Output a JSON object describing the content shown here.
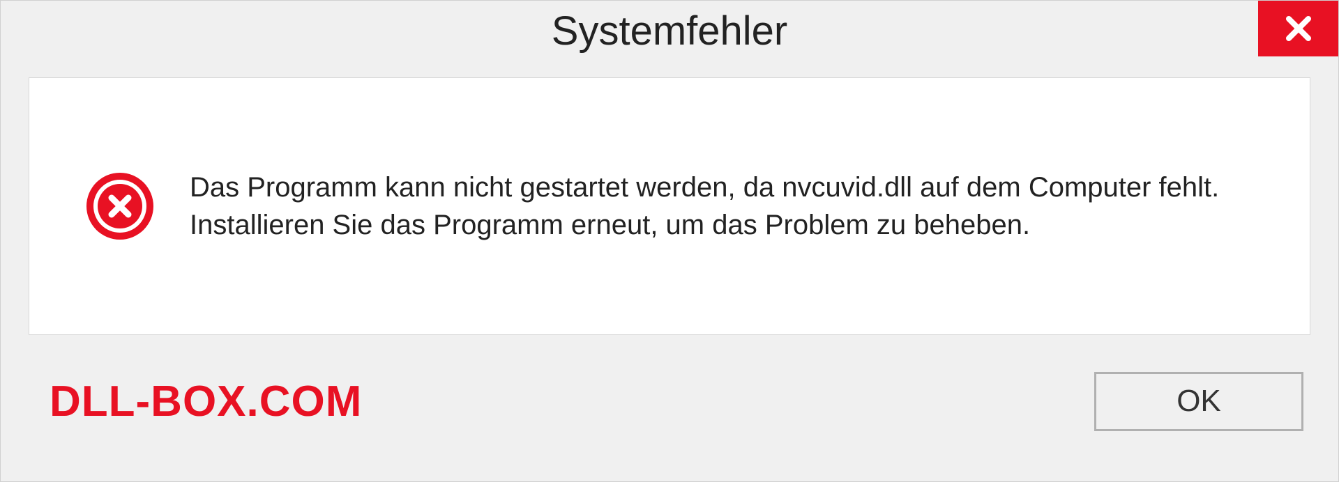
{
  "dialog": {
    "title": "Systemfehler",
    "message": "Das Programm kann nicht gestartet werden, da nvcuvid.dll auf dem Computer fehlt. Installieren Sie das Programm erneut, um das Problem zu beheben.",
    "ok_label": "OK"
  },
  "watermark": "DLL-BOX.COM",
  "colors": {
    "accent_red": "#e81123",
    "background": "#f0f0f0",
    "content_bg": "#ffffff"
  }
}
